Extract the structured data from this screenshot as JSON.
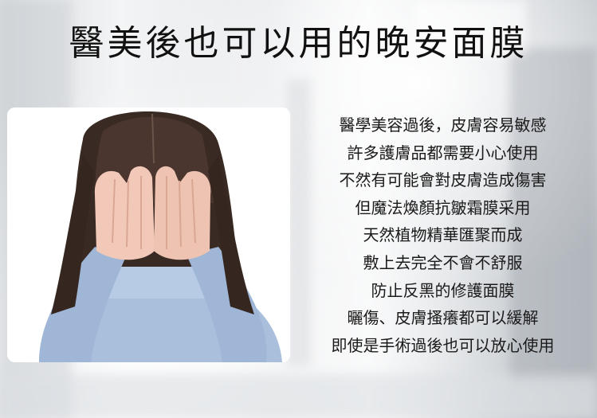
{
  "title": "醫美後也可以用的晚安面膜",
  "photo": {
    "alt": "woman-covering-face"
  },
  "lines": [
    "醫學美容過後，皮膚容易敏感",
    "許多護膚品都需要小心使用",
    "不然有可能會對皮膚造成傷害",
    "但魔法煥顏抗皺霜膜采用",
    "天然植物精華匯聚而成",
    "敷上去完全不會不舒服",
    "防止反黑的修護面膜",
    "曬傷、皮膚搔癢都可以緩解",
    "即使是手術過後也可以放心使用"
  ],
  "colors": {
    "text": "#1a1a1a",
    "sweater": "#a9bfdc",
    "hair": "#3a2a24",
    "skin": "#f2c9b8"
  }
}
